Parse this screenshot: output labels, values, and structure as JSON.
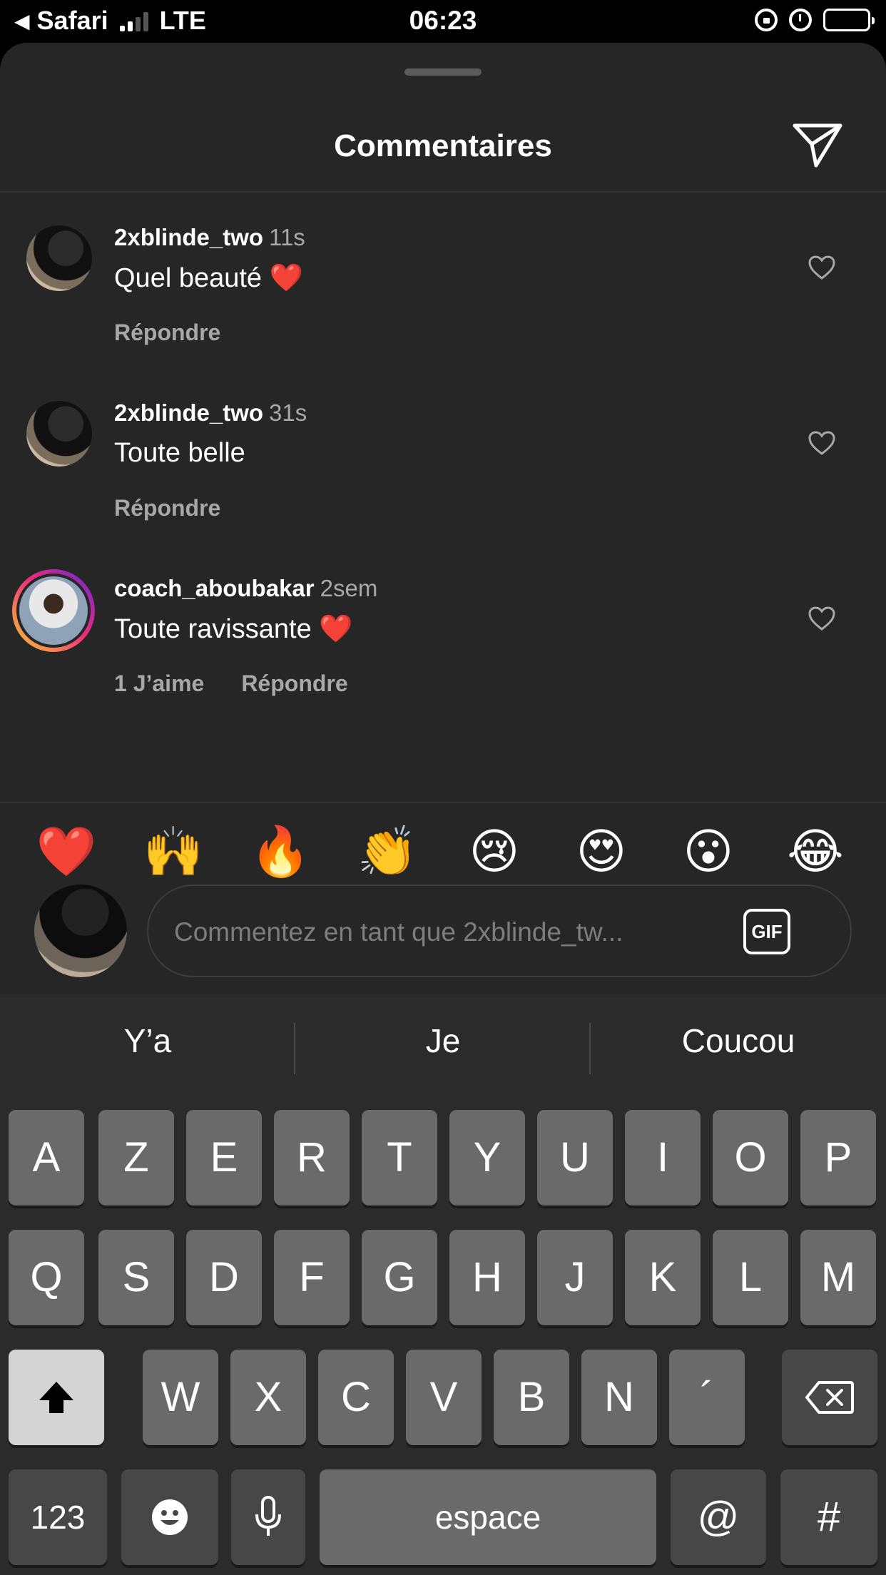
{
  "status_bar": {
    "back_app": "Safari",
    "network": "LTE",
    "time": "06:23"
  },
  "sheet": {
    "title": "Commentaires"
  },
  "comments": [
    {
      "username": "2xblinde_two",
      "time": "11s",
      "text": "Quel beauté ❤️",
      "likes": "",
      "reply": "Répondre"
    },
    {
      "username": "2xblinde_two",
      "time": "31s",
      "text": "Toute belle",
      "likes": "",
      "reply": "Répondre"
    },
    {
      "username": "coach_aboubakar",
      "time": "2sem",
      "text": "Toute ravissante ❤️",
      "likes": "1 J’aime",
      "reply": "Répondre"
    }
  ],
  "emoji_bar": [
    "❤️",
    "🙌",
    "🔥",
    "👏",
    "😢",
    "😍",
    "😮",
    "😂"
  ],
  "comment_input": {
    "placeholder": "Commentez en tant que 2xblinde_tw...",
    "gif_label": "GIF"
  },
  "keyboard": {
    "suggestions": [
      "Y’a",
      "Je",
      "Coucou"
    ],
    "row1": [
      "A",
      "Z",
      "E",
      "R",
      "T",
      "Y",
      "U",
      "I",
      "O",
      "P"
    ],
    "row2": [
      "Q",
      "S",
      "D",
      "F",
      "G",
      "H",
      "J",
      "K",
      "L",
      "M"
    ],
    "row3": [
      "W",
      "X",
      "C",
      "V",
      "B",
      "N",
      "´"
    ],
    "numbers_key": "123",
    "space_key": "espace",
    "at_key": "@",
    "hash_key": "#"
  }
}
